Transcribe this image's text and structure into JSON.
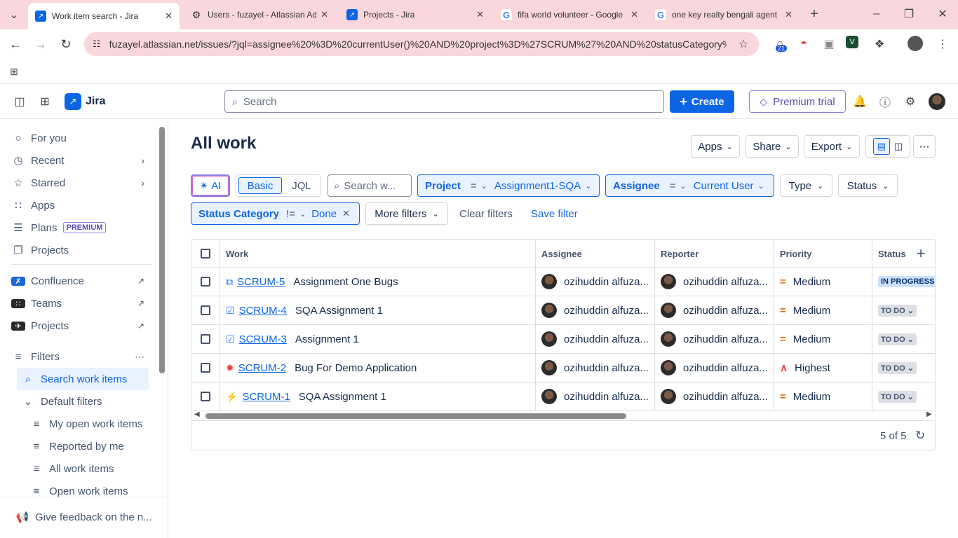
{
  "browser": {
    "tabs": [
      {
        "title": "Work item search - Jira",
        "icon": "jira-icon",
        "active": true
      },
      {
        "title": "Users - fuzayel - Atlassian Ad",
        "icon": "gear-icon",
        "active": false
      },
      {
        "title": "Projects - Jira",
        "icon": "jira-icon",
        "active": false
      },
      {
        "title": "fifa world volunteer - Google",
        "icon": "google-icon",
        "active": false
      },
      {
        "title": "one key realty bengali agent",
        "icon": "google-icon",
        "active": false
      }
    ],
    "url": "fuzayel.atlassian.net/issues/?jql=assignee%20%3D%20currentUser()%20AND%20project%3D%27SCRUM%27%20AND%20statusCategory%20...",
    "extension_badge": "21"
  },
  "topbar": {
    "app_name": "Jira",
    "search_placeholder": "Search",
    "create_label": "Create",
    "premium_label": "Premium trial"
  },
  "sidebar": {
    "items": [
      {
        "label": "For you",
        "icon": "user-circle-icon"
      },
      {
        "label": "Recent",
        "icon": "clock-icon"
      },
      {
        "label": "Starred",
        "icon": "star-icon"
      },
      {
        "label": "Apps",
        "icon": "apps-icon"
      },
      {
        "label": "Plans",
        "icon": "plans-icon",
        "tag": "PREMIUM"
      },
      {
        "label": "Projects",
        "icon": "projects-icon"
      },
      {
        "label": "Confluence",
        "icon": "confluence-icon"
      },
      {
        "label": "Teams",
        "icon": "teams-icon"
      },
      {
        "label": "Projects",
        "icon": "rocket-icon"
      },
      {
        "label": "Filters",
        "icon": "filter-icon"
      },
      {
        "label": "Search work items",
        "icon": "search-icon"
      },
      {
        "label": "Default filters",
        "icon": "chevron-down-icon"
      },
      {
        "label": "My open work items",
        "icon": "filter-lines-icon"
      },
      {
        "label": "Reported by me",
        "icon": "filter-lines-icon"
      },
      {
        "label": "All work items",
        "icon": "filter-lines-icon"
      },
      {
        "label": "Open work items",
        "icon": "filter-lines-icon"
      }
    ],
    "feedback": "Give feedback on the n..."
  },
  "main": {
    "title": "All work",
    "actions": {
      "apps": "Apps",
      "share": "Share",
      "export": "Export"
    },
    "modes": {
      "ai": "AI",
      "basic": "Basic",
      "jql": "JQL"
    },
    "search_placeholder": "Search w...",
    "filters": {
      "project_key": "Project",
      "project_op": "=",
      "project_val": "Assignment1-SQA",
      "assignee_key": "Assignee",
      "assignee_op": "=",
      "assignee_val": "Current User",
      "type": "Type",
      "status": "Status",
      "statuscat_key": "Status Category",
      "statuscat_op": "!=",
      "statuscat_val": "Done",
      "more": "More filters",
      "clear": "Clear filters",
      "save": "Save filter"
    },
    "columns": [
      "Work",
      "Assignee",
      "Reporter",
      "Priority",
      "Status"
    ],
    "rows": [
      {
        "key": "SCRUM-5",
        "summary": "Assignment One Bugs",
        "type_icon": "subtask-icon",
        "assignee": "ozihuddin alfuza...",
        "reporter": "ozihuddin alfuza...",
        "priority": "Medium",
        "status": "IN PROGRESS"
      },
      {
        "key": "SCRUM-4",
        "summary": "SQA Assignment 1",
        "type_icon": "task-icon",
        "assignee": "ozihuddin alfuza...",
        "reporter": "ozihuddin alfuza...",
        "priority": "Medium",
        "status": "TO DO"
      },
      {
        "key": "SCRUM-3",
        "summary": "Assignment 1",
        "type_icon": "task-icon",
        "assignee": "ozihuddin alfuza...",
        "reporter": "ozihuddin alfuza...",
        "priority": "Medium",
        "status": "TO DO"
      },
      {
        "key": "SCRUM-2",
        "summary": "Bug For Demo Application",
        "type_icon": "bug-icon",
        "assignee": "ozihuddin alfuza...",
        "reporter": "ozihuddin alfuza...",
        "priority": "Highest",
        "status": "TO DO"
      },
      {
        "key": "SCRUM-1",
        "summary": "SQA Assignment 1",
        "type_icon": "epic-icon",
        "assignee": "ozihuddin alfuza...",
        "reporter": "ozihuddin alfuza...",
        "priority": "Medium",
        "status": "TO DO"
      }
    ],
    "pagination": "5 of 5"
  },
  "colors": {
    "accent": "#0c66e4",
    "premium": "#5e4db2",
    "tab_bg": "#f9d7dc"
  }
}
